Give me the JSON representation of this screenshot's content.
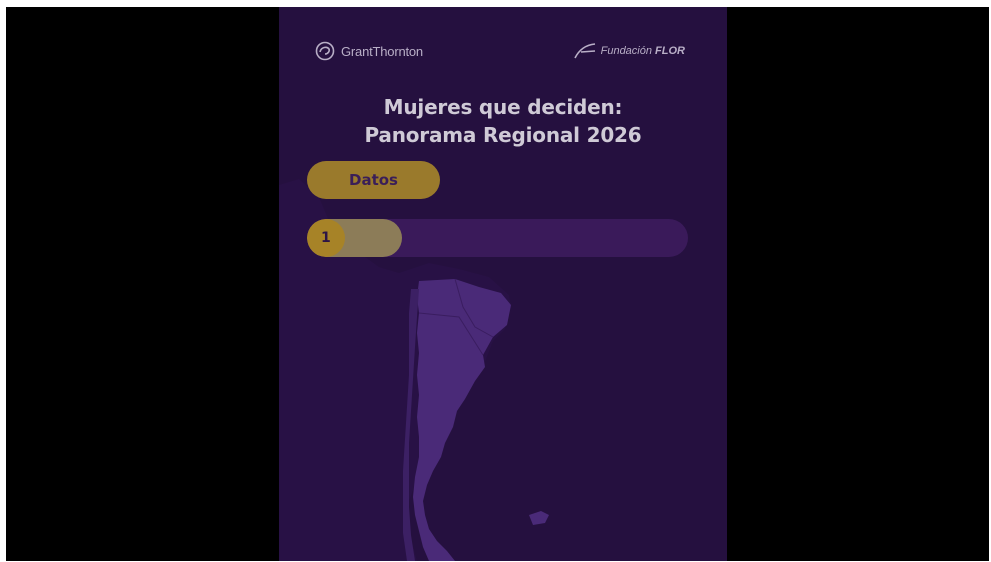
{
  "logos": {
    "grant_thornton": "GrantThornton",
    "fundacion_flor_prefix": "Fundación",
    "fundacion_flor_strong": "FLOR"
  },
  "slide": {
    "title_line1": "Mujeres que deciden:",
    "title_line2": "Panorama Regional 2026",
    "section_label": "Datos",
    "step_number": "1",
    "progress_fraction": 0.25
  },
  "colors": {
    "background": "#25103f",
    "accent_gold": "#a78327",
    "map_fill": "#4a2a78"
  },
  "icons": {
    "grant_thornton_logo": "gt-swirl-icon",
    "fundacion_flor_logo": "flor-swoosh-icon"
  }
}
